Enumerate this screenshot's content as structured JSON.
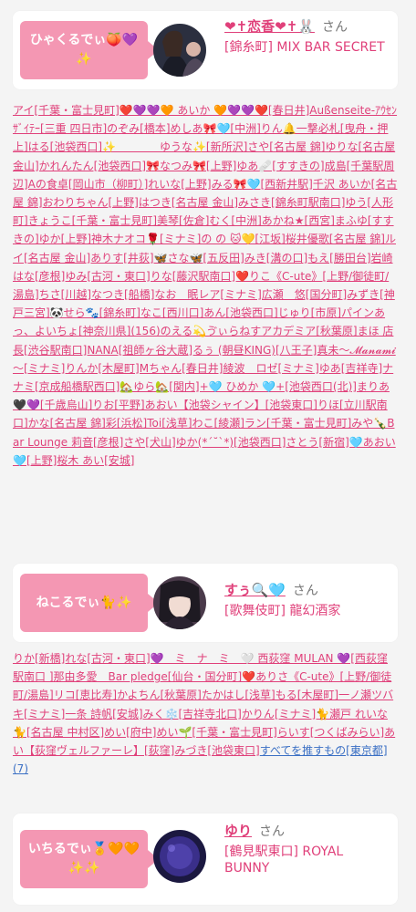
{
  "sections": [
    {
      "badge": "ひゃくるでぃ🍑💜✨",
      "name": "❤︎✝恋香❤︎✝🐰",
      "honorific": "さん",
      "shop": "[錦糸町] MIX BAR SECRET",
      "supporters": [
        "アイ[千葉・富士見町]❤️💜💜🧡 あいか 🧡💜💜❤️[春日井]Außenseite-ｱｳｾﾝｻﾞｲﾃｰ[三重 四日市]のぞみ[橋本]めしあ🎀🩵[中洲]りん🔔一撃必札[曳舟・押上]はる[池袋西口]✨　　　　ゆうな✨[新所沢]さや[名古屋 錦]ゆりな[名古屋 金山]かれんたん[池袋西口]🎀なつみ🎀[上野]ゆあ🩹[すすきの]成島[千葉駅周辺]Aの食卓[岡山市（柳町）]れいな[上野]みる🎀🩵[西新井駅]千沢 あいか[名古屋 錦]おわりちゃん[上野]はつき[名古屋 金山]みさき[錦糸町駅南口]ゆう[人形町]きょうこ[千葉・富士見町]美琴[佐倉]むく[中洲]あかね★[西宮]まふゆ[すすきの]ゆか[上野]神木ナオコ🌹[ミナミ]の の 🐱💛[江坂]桜井優歌[名古屋 錦]ルイ[名古屋 金山]ありす[井荻]🦋さな🦋[五反田]みき[溝の口]もえ[勝田台]岩崎はな[彦根]ゆみ[古河・東口]りな[藤沢駅南口]❤️りこ《C-ute》[上野/御徒町/湯島]ちさ[川越]なつき[船橋]なお　眠レア[ミナミ]広瀬　悠[国分町]みずき[神戸三宮]🐼せら🐾[錦糸町]なこ[西川口]あん[池袋西口]じゅり[市原]パインあっ、よいちょ[神奈川県](156)のえる💫ゔぃらねすアカデミア[秋葉原]まほ 店長[渋谷駅南口]NANA[祖師ヶ谷大蔵]るぅ (朝昼KING)[八王子]真未～𝓜𝓪𝓷𝓪𝓶𝓲 ～[ミナミ]りんか[木屋町]Mちゃん[春日井]綾波　ロゼ[ミナミ]ゆあ[吉祥寺]ナナミ[京成船橋駅西口]🏡ゆら🏡[関内]+🩵 ひめか 🩵+[池袋西口(北)]まりあ🖤💜[千歳烏山]りお[平野]あおい【池袋シャイン】[池袋東口]りほ[立川駅南口]かな[名古屋 錦]彩[浜松]Toi[浅草]わこ[綾瀬]ラン[千葉・富士見町]みや🍾Bar Lounge 莉音[彦根]さや[犬山]ゆか(*´˘`*)[池袋西口]さとう[新宿]🩵あおい🩵[上野]桜木 あい[安城]"
      ]
    },
    {
      "badge": "ねこるでぃ🐈✨",
      "name": "すぅ🔍🩵",
      "honorific": "さん",
      "shop": "[歌舞伎町] 龍幻酒家",
      "supporters": [
        "りか[新橋]れな[古河・東口]💜　ミ　ナ　ミ　🤍 西荻窪 MULAN 💜[西荻窪駅南口 ]那由多愛　Bar pledge[仙台・国分町]❤️ありさ《C-ute》[上野/御徒町/湯島]リコ[恵比寿]かよちん[秋葉原]たかはし[浅草]もる[木屋町]一ノ瀬ツバキ[ミナミ]一条 詩帆[安城]みく❄️[吉祥寺北口]かりん[ミナミ]🐈瀬戸 れいな🐈[名古屋 中村区]めい[府中]めい🌱[千葉・富士見町]らいす[つくばみらい]あい【荻窪ヴェルファーレ】[荻窪]みづき[池袋東口]"
      ],
      "see_all": "すべてを推すもの[東京都](7)"
    },
    {
      "badge": "いちるでぃ🏅🧡🧡✨✨",
      "name": "ゆり",
      "honorific": "さん",
      "shop": "[鶴見駅東口] ROYAL BUNNY"
    }
  ],
  "colors": {
    "accent": "#e0407a",
    "badge_bg": "#f497b3",
    "link_blue": "#3a6fc4",
    "page_bg": "#f4f4f4"
  }
}
